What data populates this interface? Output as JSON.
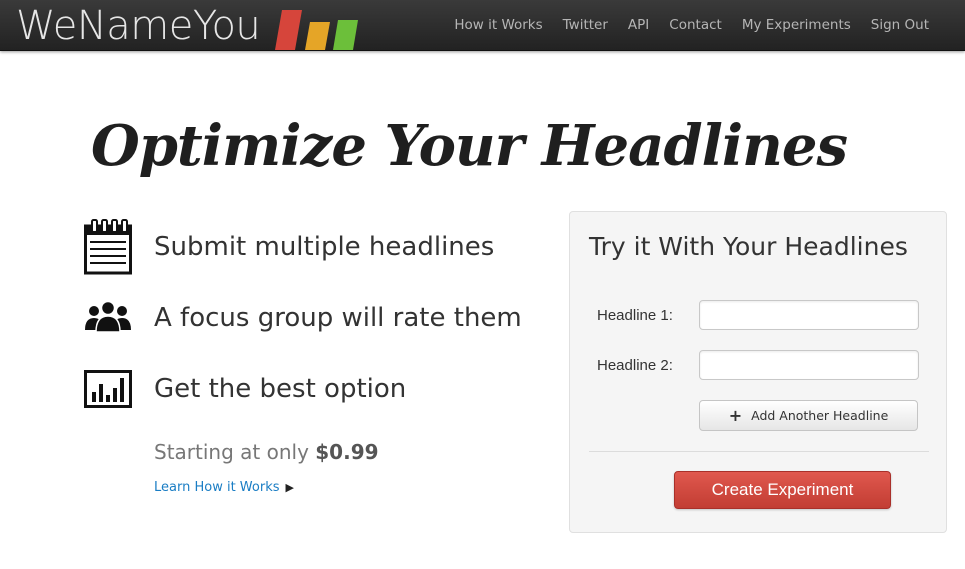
{
  "brand": {
    "name": "WeNameYou"
  },
  "nav": {
    "items": [
      {
        "label": "How it Works"
      },
      {
        "label": "Twitter"
      },
      {
        "label": "API"
      },
      {
        "label": "Contact"
      },
      {
        "label": "My Experiments"
      },
      {
        "label": "Sign Out"
      }
    ]
  },
  "hero": {
    "title": "Optimize Your Headlines"
  },
  "features": [
    {
      "icon": "notepad-icon",
      "text": "Submit multiple headlines"
    },
    {
      "icon": "group-icon",
      "text": "A focus group will rate them"
    },
    {
      "icon": "bar-chart-icon",
      "text": "Get the best option"
    }
  ],
  "pricing": {
    "prefix": "Starting at only",
    "price": "$0.99"
  },
  "learn_link": {
    "label": "Learn How it Works",
    "icon": "chevron-right-icon"
  },
  "form": {
    "title": "Try it With Your Headlines",
    "fields": [
      {
        "label": "Headline 1:",
        "value": "",
        "placeholder": ""
      },
      {
        "label": "Headline 2:",
        "value": "",
        "placeholder": ""
      }
    ],
    "add_button": {
      "label": "Add Another Headline",
      "icon": "plus-icon"
    },
    "submit_button": {
      "label": "Create Experiment"
    }
  },
  "colors": {
    "navbar": "#2b2b2b",
    "link": "#1a7dc4",
    "submit": "#d24a40",
    "logo_bars": [
      "#d6453b",
      "#e5a527",
      "#6cbf3a",
      "#4fae2e"
    ]
  }
}
